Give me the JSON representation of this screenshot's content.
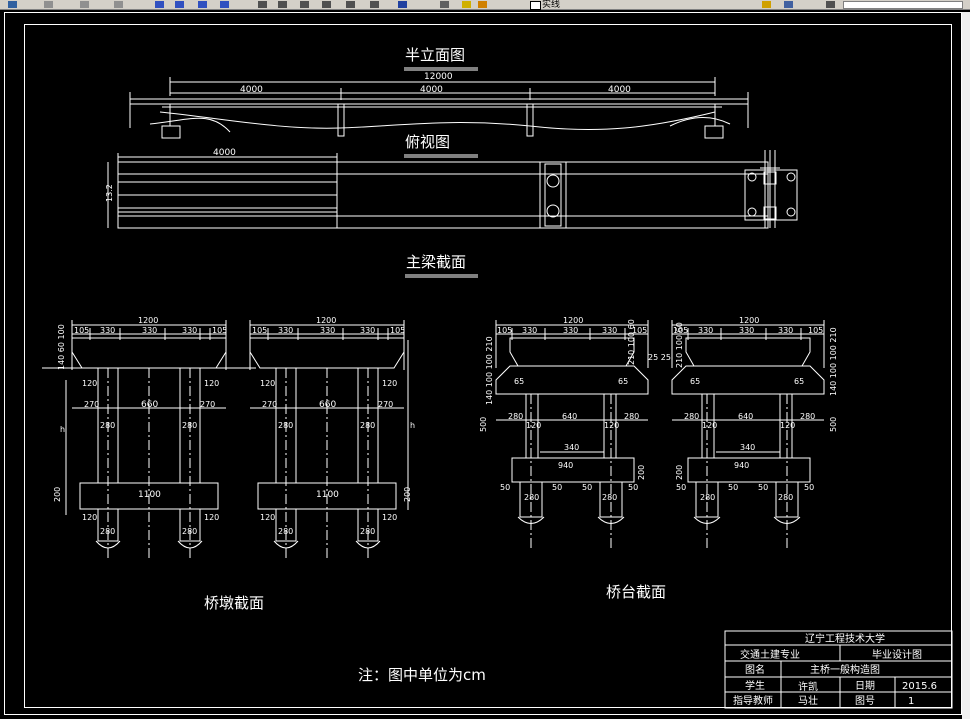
{
  "toolbar": {
    "layer_name": "实线"
  },
  "views": {
    "elevation_title": "半立面图",
    "plan_title": "俯视图",
    "girder_section_title": "主梁截面",
    "pier_section_title": "桥墩截面",
    "abutment_section_title": "桥台截面"
  },
  "elevation": {
    "total": "12000",
    "spans": [
      "4000",
      "4000",
      "4000"
    ]
  },
  "plan": {
    "span": "4000",
    "width": "13.2"
  },
  "girder_dims": {
    "total": "1200",
    "edge": "105",
    "segments": [
      "330",
      "330",
      "330"
    ],
    "edge_r": "105"
  },
  "pier": {
    "overhang": "120",
    "left": "270",
    "mid": "660",
    "right": "270",
    "col": "280",
    "cap_width": "1100",
    "cap_h": "200",
    "pile": "280",
    "side_h": "h",
    "left_stack": "140 60 100"
  },
  "abutment": {
    "left_stack": "140 100 100 210",
    "right_stack": "210 100 60",
    "hunch": "25 25",
    "haunch": "65",
    "left": "280",
    "mid": "640",
    "right": "280",
    "inner": "120",
    "footing_top": "340",
    "footing": "940",
    "footing_h": "200",
    "side_h": "500",
    "edge_small": "50",
    "pile": "280",
    "total_h": "300"
  },
  "note": "注：图中单位为cm",
  "title_block": {
    "school": "辽宁工程技术大学",
    "major": "交通土建专业",
    "design_type": "毕业设计图",
    "drawing_name_label": "图名",
    "drawing_name": "主桥一般构造图",
    "student_label": "学生",
    "student": "许凯",
    "date_label": "日期",
    "date": "2015.6",
    "advisor_label": "指导教师",
    "advisor": "马壮",
    "drawing_no_label": "图号",
    "drawing_no": "1"
  }
}
